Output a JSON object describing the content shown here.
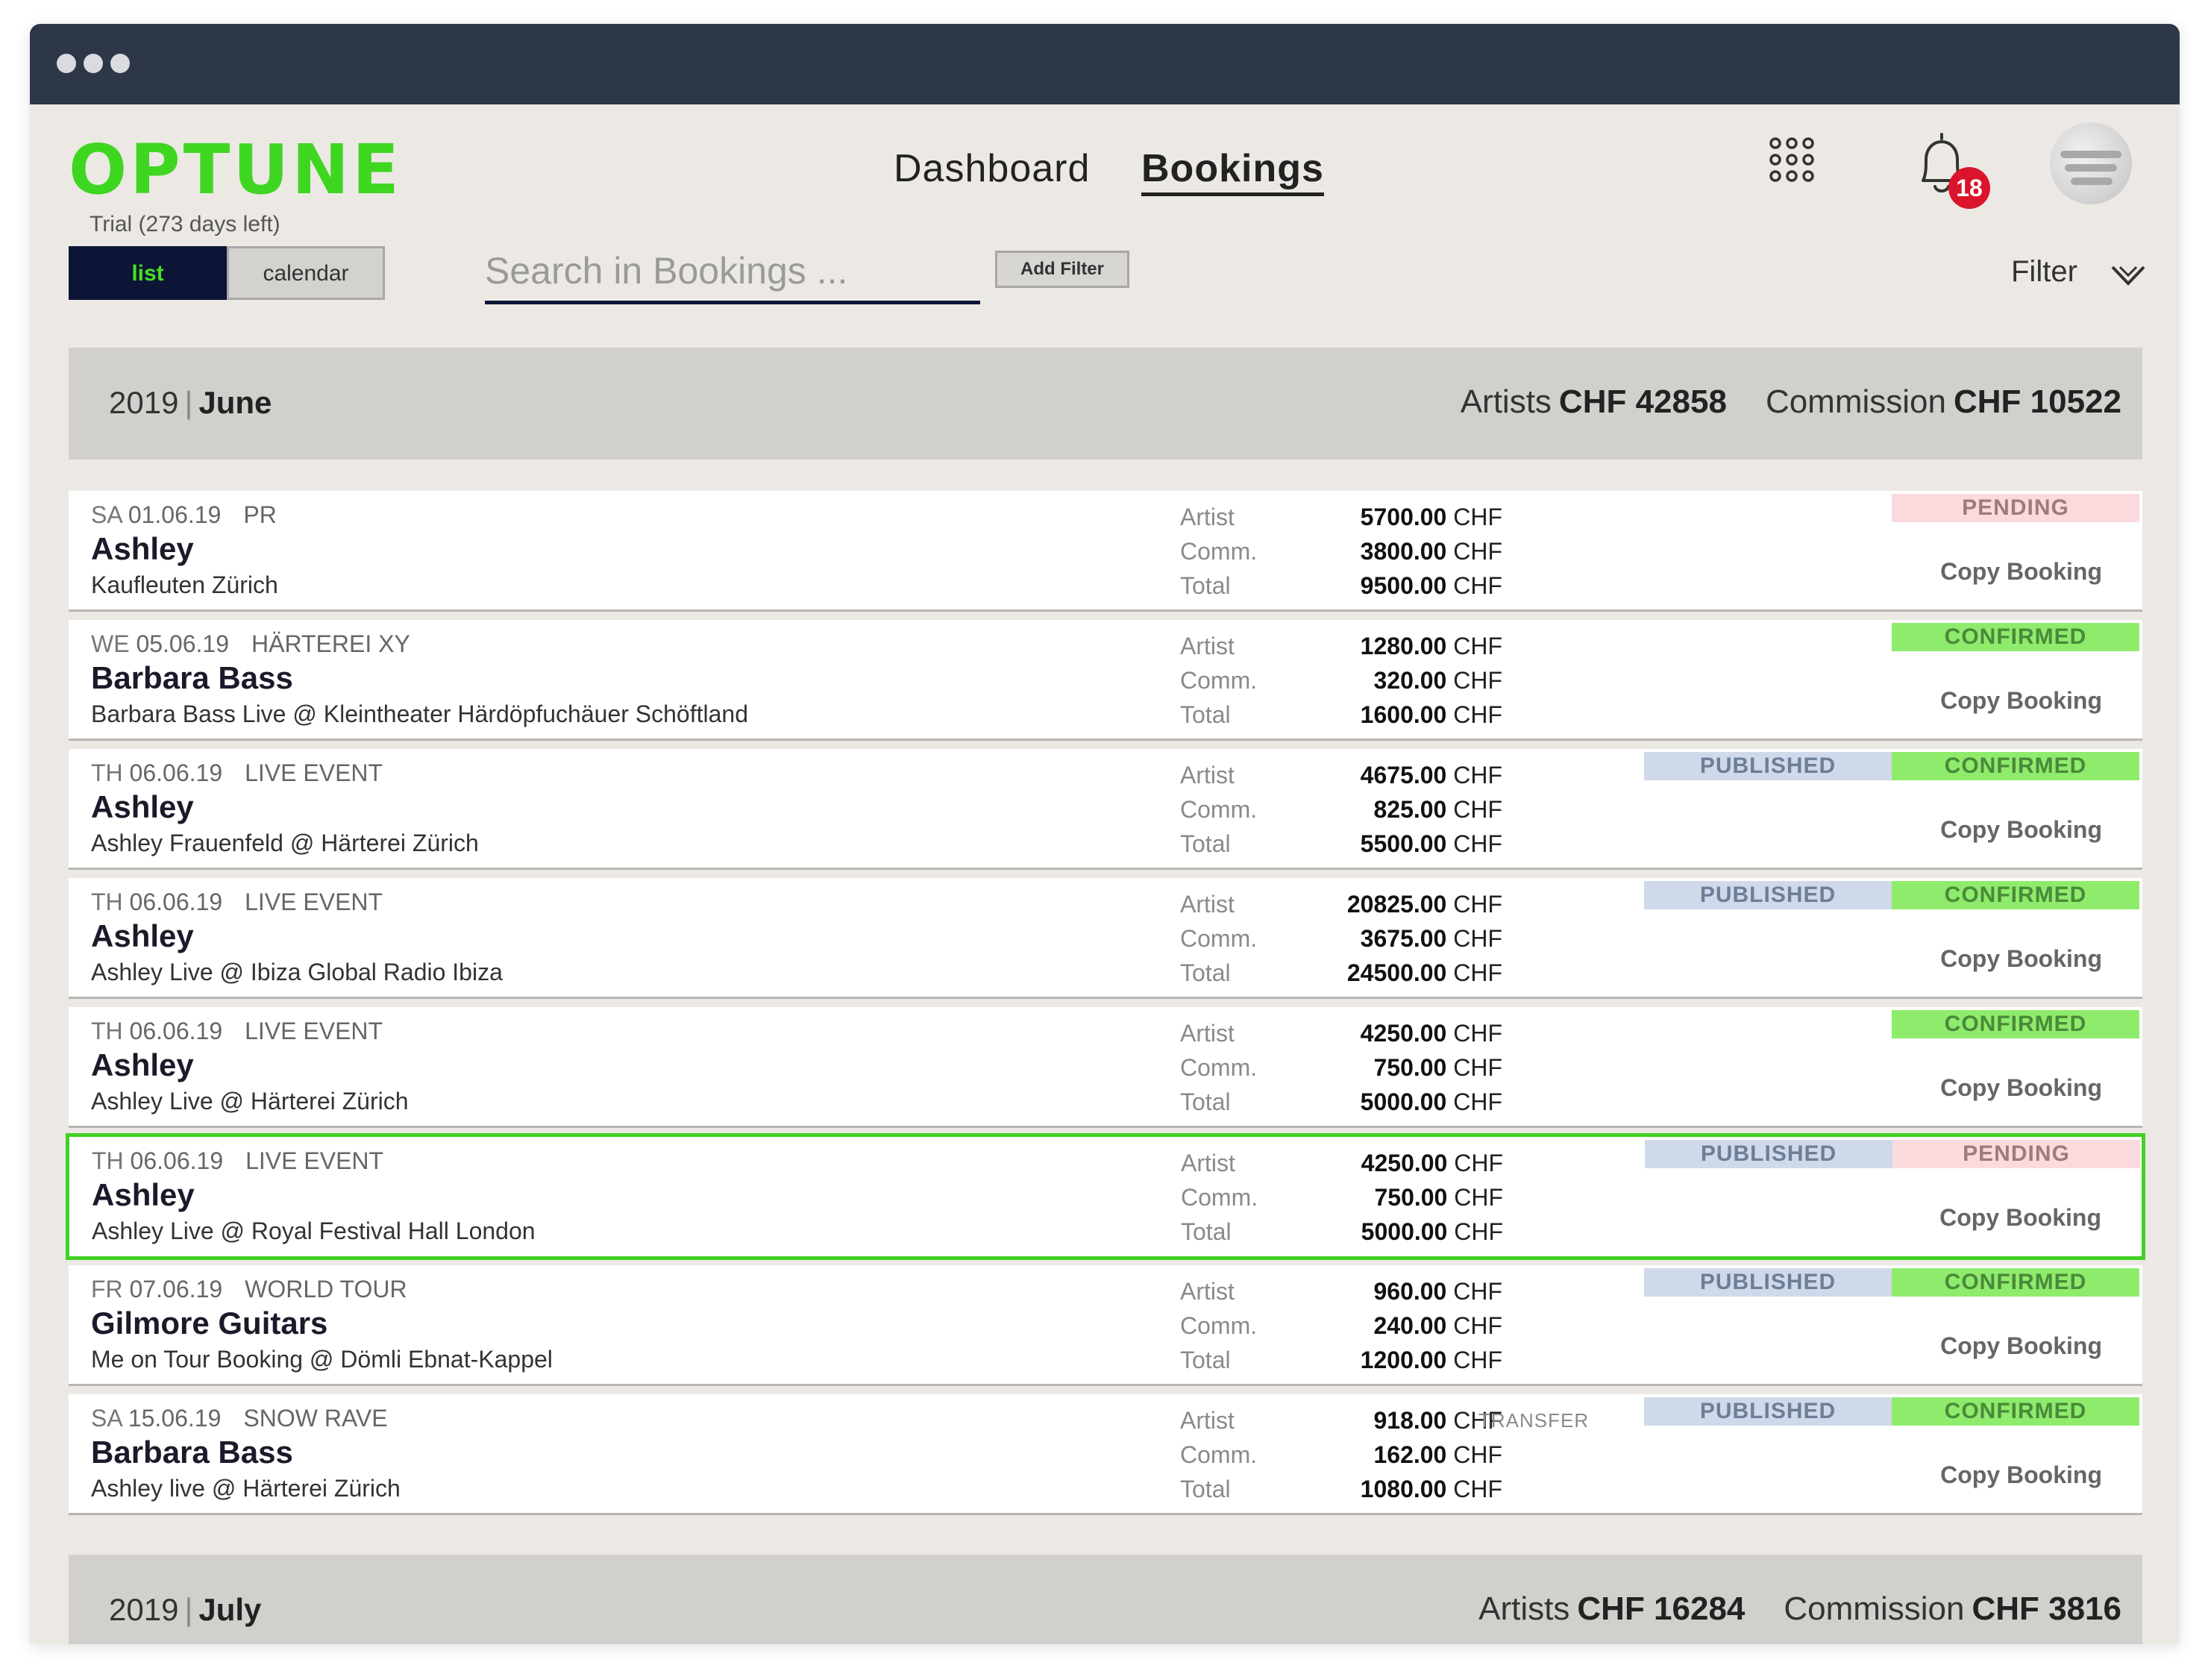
{
  "app": {
    "logo": "OPTUNE",
    "trial": "Trial (273 days left)"
  },
  "nav": {
    "dashboard": "Dashboard",
    "bookings": "Bookings"
  },
  "header": {
    "notification_count": "18"
  },
  "view_toggle": {
    "list": "list",
    "calendar": "calendar"
  },
  "search": {
    "placeholder": "Search in Bookings ...",
    "value": ""
  },
  "toolbar": {
    "add_filter": "Add Filter",
    "filter": "Filter"
  },
  "labels": {
    "artist": "Artist",
    "comm": "Comm.",
    "total": "Total",
    "copy_booking": "Copy Booking",
    "artists_total": "Artists",
    "commission_total": "Commission"
  },
  "months": [
    {
      "year": "2019",
      "month": "June",
      "artists": "CHF 42858",
      "commission": "CHF 10522"
    },
    {
      "year": "2019",
      "month": "July",
      "artists": "CHF 16284",
      "commission": "CHF 3816"
    }
  ],
  "bookings": [
    {
      "day": "SA",
      "date": "01.06.19",
      "tag": "PR",
      "name": "Ashley",
      "venue": "Kaufleuten Zürich",
      "artist": "5700.00",
      "comm": "3800.00",
      "total": "9500.00",
      "currency": "CHF",
      "published": "",
      "status": "PENDING",
      "transfer": ""
    },
    {
      "day": "WE",
      "date": "05.06.19",
      "tag": "HÄRTEREI XY",
      "name": "Barbara Bass",
      "venue": "Barbara Bass Live @ Kleintheater Härdöpfuchäuer Schöftland",
      "artist": "1280.00",
      "comm": "320.00",
      "total": "1600.00",
      "currency": "CHF",
      "published": "",
      "status": "CONFIRMED",
      "transfer": ""
    },
    {
      "day": "TH",
      "date": "06.06.19",
      "tag": "LIVE EVENT",
      "name": "Ashley",
      "venue": "Ashley Frauenfeld @ Härterei Zürich",
      "artist": "4675.00",
      "comm": "825.00",
      "total": "5500.00",
      "currency": "CHF",
      "published": "PUBLISHED",
      "status": "CONFIRMED",
      "transfer": ""
    },
    {
      "day": "TH",
      "date": "06.06.19",
      "tag": "LIVE EVENT",
      "name": "Ashley",
      "venue": "Ashley Live @ Ibiza Global Radio Ibiza",
      "artist": "20825.00",
      "comm": "3675.00",
      "total": "24500.00",
      "currency": "CHF",
      "published": "PUBLISHED",
      "status": "CONFIRMED",
      "transfer": ""
    },
    {
      "day": "TH",
      "date": "06.06.19",
      "tag": "LIVE EVENT",
      "name": "Ashley",
      "venue": "Ashley Live @ Härterei Zürich",
      "artist": "4250.00",
      "comm": "750.00",
      "total": "5000.00",
      "currency": "CHF",
      "published": "",
      "status": "CONFIRMED",
      "transfer": ""
    },
    {
      "day": "TH",
      "date": "06.06.19",
      "tag": "LIVE EVENT",
      "name": "Ashley",
      "venue": "Ashley Live @ Royal Festival Hall London",
      "artist": "4250.00",
      "comm": "750.00",
      "total": "5000.00",
      "currency": "CHF",
      "published": "PUBLISHED",
      "status": "PENDING",
      "transfer": ""
    },
    {
      "day": "FR",
      "date": "07.06.19",
      "tag": "WORLD TOUR",
      "name": "Gilmore Guitars",
      "venue": "Me on Tour Booking @ Dömli Ebnat-Kappel",
      "artist": "960.00",
      "comm": "240.00",
      "total": "1200.00",
      "currency": "CHF",
      "published": "PUBLISHED",
      "status": "CONFIRMED",
      "transfer": ""
    },
    {
      "day": "SA",
      "date": "15.06.19",
      "tag": "SNOW RAVE",
      "name": "Barbara Bass",
      "venue": "Ashley live @ Härterei Zürich",
      "artist": "918.00",
      "comm": "162.00",
      "total": "1080.00",
      "currency": "CHF",
      "published": "PUBLISHED",
      "status": "CONFIRMED",
      "transfer": "TRANSFER"
    }
  ],
  "colors": {
    "brand_green": "#3fd621",
    "navy": "#0c1535",
    "titlebar": "#2e3748",
    "badge_red": "#d9142b",
    "confirmed": "#8feb6c",
    "pending": "#fbdadd",
    "published": "#cfd9ea"
  }
}
